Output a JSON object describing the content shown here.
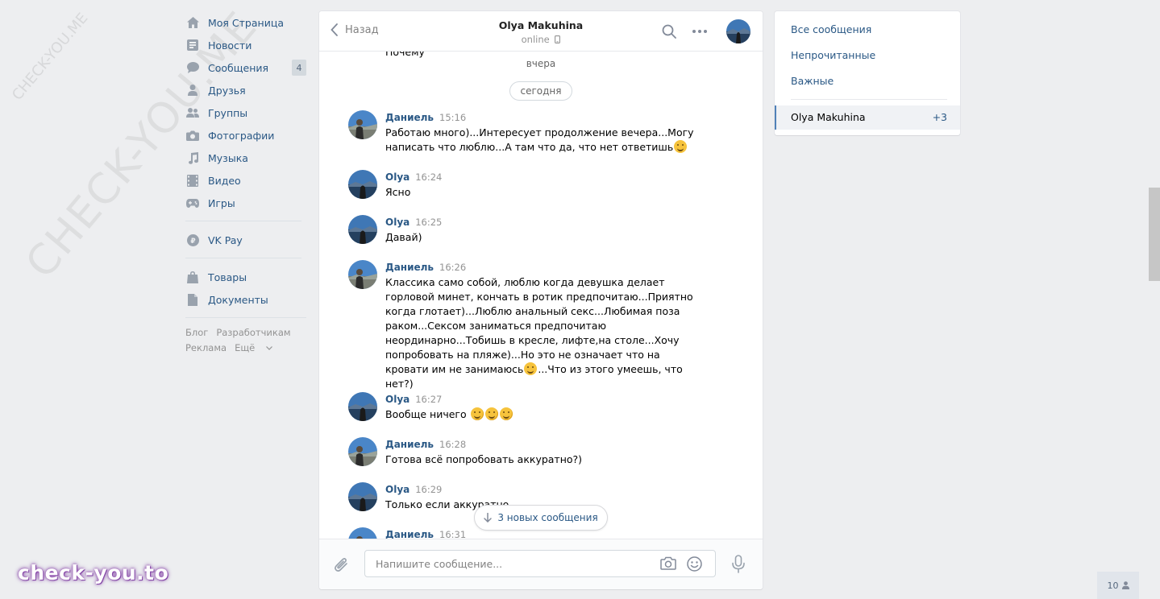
{
  "watermarks": {
    "diagonal": "CHECK-YOU.ME",
    "small": "CHECK-YOU.ME",
    "logo": "check-you.to"
  },
  "nav": {
    "items": [
      {
        "label": "Моя Страница",
        "icon": "home-icon"
      },
      {
        "label": "Новости",
        "icon": "news-icon"
      },
      {
        "label": "Сообщения",
        "icon": "messages-icon",
        "count": "4"
      },
      {
        "label": "Друзья",
        "icon": "friends-icon"
      },
      {
        "label": "Группы",
        "icon": "groups-icon"
      },
      {
        "label": "Фотографии",
        "icon": "camera-icon"
      },
      {
        "label": "Музыка",
        "icon": "music-icon"
      },
      {
        "label": "Видео",
        "icon": "video-icon"
      },
      {
        "label": "Игры",
        "icon": "games-icon"
      }
    ],
    "vkpay": {
      "label": "VK Pay",
      "icon": "vkpay-icon"
    },
    "extra": [
      {
        "label": "Товары",
        "icon": "bag-icon"
      },
      {
        "label": "Документы",
        "icon": "document-icon"
      }
    ],
    "footer": {
      "blog": "Блог",
      "developers": "Разработчикам",
      "ads": "Реклама",
      "more": "Ещё"
    }
  },
  "chat": {
    "back_label": "Назад",
    "peer_name": "Olya Makuhina",
    "peer_status": "online",
    "truncated_text": "Почему",
    "day_yesterday": "вчера",
    "day_today": "сегодня",
    "messages": [
      {
        "author": "Даниель",
        "time": "15:16",
        "text": "Работаю много)...Интересует продолжение вечера...Могу написать что люблю...А там что да, что нет ответишь",
        "emoji_after": "smirk-emoji"
      },
      {
        "author": "Olya",
        "time": "16:24",
        "text": "Ясно"
      },
      {
        "author": "Olya",
        "time": "16:25",
        "text": "Давай)"
      },
      {
        "author": "Даниель",
        "time": "16:26",
        "text": "Классика само собой, люблю когда девушка делает горловой минет, кончать в ротик предпочитаю...Приятно когда глотает)...Люблю анальный секс...Любимая поза раком...Сексом заниматься предпочитаю неординарно...Тобишь в кресле, лифте,на столе...Хочу попробовать на пляже)...Но это не означает что на кровати им не занимаюсь",
        "text_after_emoji": "...Что из этого умеешь, что нет?)",
        "emoji_inline": "blush-emoji"
      },
      {
        "author": "Olya",
        "time": "16:27",
        "text": "Вообще ничего",
        "emoji_after": "sweat-smile-emoji x3"
      },
      {
        "author": "Даниель",
        "time": "16:28",
        "text": "Готова всё попробовать аккуратно?)"
      },
      {
        "author": "Olya",
        "time": "16:29",
        "text": "Только если аккуратно"
      },
      {
        "author": "Даниель",
        "time": "16:31",
        "text": ""
      }
    ],
    "new_messages": "3 новых сообщения",
    "composer_placeholder": "Напишите сообщение..."
  },
  "filters": {
    "all": "Все сообщения",
    "unread": "Непрочитанные",
    "important": "Важные",
    "conversation": {
      "name": "Olya Makuhina",
      "count": "+3"
    }
  },
  "online_count": "10",
  "colors": {
    "accent": "#2a5885",
    "page_bg": "#edeef0",
    "badge_bg": "#d3d9de",
    "active_border": "#5181b8"
  }
}
